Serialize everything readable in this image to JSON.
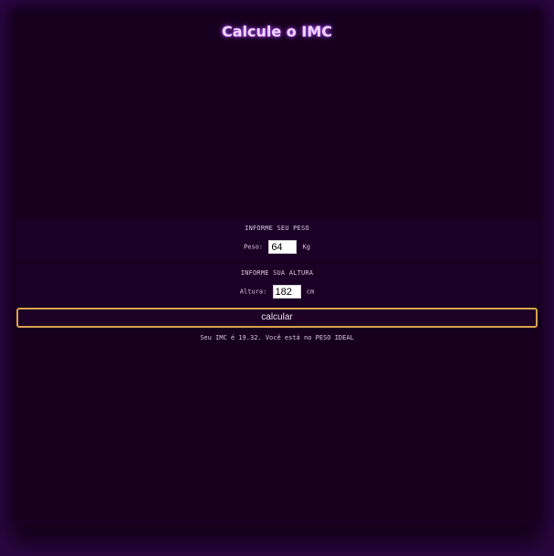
{
  "header": {
    "title": "Calcule o IMC"
  },
  "peso": {
    "section_label": "INFORME SEU PESO",
    "field_label": "Peso:",
    "value": "64",
    "unit": "Kg"
  },
  "altura": {
    "section_label": "INFORME SUA ALTURA",
    "field_label": "Altura:",
    "value": "182",
    "unit": "cm"
  },
  "actions": {
    "calculate_label": "calcular"
  },
  "result": {
    "text": "Seu IMC é 19.32. Você está no PESO IDEAL"
  },
  "theme": {
    "background": "#140019",
    "title_glow": "#b04dff",
    "button_border": "#d9a24e"
  }
}
